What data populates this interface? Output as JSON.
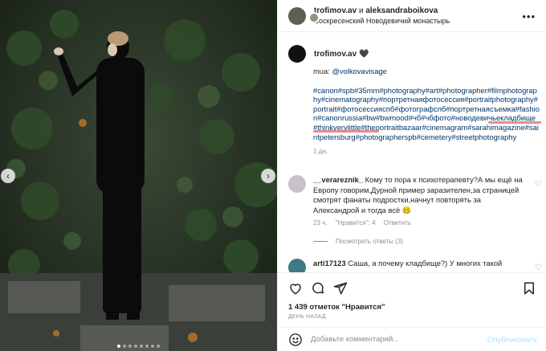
{
  "header": {
    "user1": "trofimov.av",
    "and": "и",
    "user2": "aleksandraboikova",
    "location": "Воскресенский Новодевичий монастырь",
    "more_icon": "more-horizontal-icon"
  },
  "media": {
    "prev_icon": "chevron-left-icon",
    "next_icon": "chevron-right-icon",
    "prev_glyph": "‹",
    "next_glyph": "›",
    "dots_count": 8,
    "active_dot": 0
  },
  "caption": {
    "user": "trofimov.av",
    "heart": "🖤",
    "mua_label": "mua: ",
    "mua_link": "@volkovavisage",
    "tags": "#canon#spb#35mm#photography#art#photographer#filmphotography#cinematography#портретнаяфотосессия#portraitphotography#portrait#фотосессияспб#фотографспб#портретнаясъемка#fashion#canonrussia#bw#bwmood#чб#чбфото#новодевичьекладбище#thinkverylittle#theportraitbazaar#cinemagram#sarahimagazine#saintpetersburg#photographerspb#cemetery#streetphotography",
    "time": "1 дн."
  },
  "comments": [
    {
      "user": "__verareznik_",
      "text": "Кому то пора к психотерапевту?А мы ещё на Европу говорим,Дурной пример заразителен,за страницей смотрят фанаты подростки,начнут повторять за Александрой и тогда всё 🥴",
      "time": "23 ч.",
      "likes": "\"Нравится\": 4",
      "reply": "Ответить",
      "view_replies": "Посмотреть ответы (3)"
    },
    {
      "user": "arti17123",
      "text": "Саша, а почему кладбище?) У многих такой"
    }
  ],
  "actions": {
    "like_icon": "heart-icon",
    "comment_icon": "comment-icon",
    "share_icon": "share-icon",
    "save_icon": "bookmark-icon"
  },
  "likes_text": "1 439 отметок \"Нравится\"",
  "post_date": "День назад",
  "comment_box": {
    "placeholder": "Добавьте комментарий...",
    "publish_label": "Опубликовать",
    "emoji_icon": "emoji-icon"
  },
  "colors": {
    "link": "#00376b",
    "muted": "#8e8e8e",
    "publish_disabled": "#b2dffc",
    "annotation_underline": "#e07a7a"
  }
}
